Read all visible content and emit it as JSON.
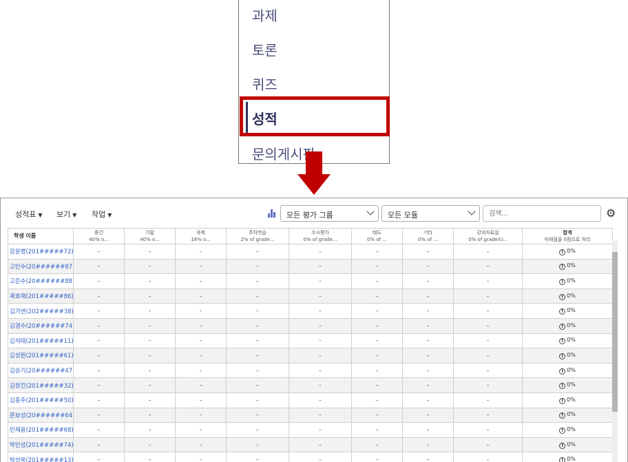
{
  "menu": {
    "items": [
      {
        "label": "과제",
        "active": false
      },
      {
        "label": "토론",
        "active": false
      },
      {
        "label": "퀴즈",
        "active": false
      },
      {
        "label": "성적",
        "active": true
      },
      {
        "label": "문의게시판",
        "active": false
      }
    ]
  },
  "toolbar": {
    "gradebook_label": "성적표",
    "view_label": "보기",
    "action_label": "작업",
    "group_select": "모든 평가 그룹",
    "module_select": "모든 모듈",
    "search_placeholder": "검색..."
  },
  "table": {
    "student_header": "학생 이름",
    "columns": [
      {
        "title": "중간",
        "sub": "40% o..."
      },
      {
        "title": "기말",
        "sub": "40% o..."
      },
      {
        "title": "과제",
        "sub": "18% o..."
      },
      {
        "title": "주차학습",
        "sub": "2% of grade..."
      },
      {
        "title": "수시평가",
        "sub": "0% of grade..."
      },
      {
        "title": "태도",
        "sub": "0% of ..."
      },
      {
        "title": "기타",
        "sub": "0% of ..."
      },
      {
        "title": "강의자료실",
        "sub": "0% of grade/U..."
      }
    ],
    "total_header": {
      "title": "합계",
      "sub": "미채점을 0점으로 처리"
    },
    "empty_value": "–",
    "total_value": "0%",
    "students": [
      "강윤병(201#####72)",
      "고민수(20######87)",
      "고은수(20######88)",
      "곽호재(201#####86)",
      "김가연(202#####38)",
      "김경수(20######74)",
      "김석태(201#####11)",
      "김성원(201#####61)",
      "김승기(20######47)",
      "김창진(201#####32)",
      "김홍주(201#####50)",
      "문보성(20######64)",
      "민재용(201#####68)",
      "박민성(201#####74)",
      "박성욱(201#####13)"
    ]
  },
  "colors": {
    "highlight": "#c00000",
    "link": "#2f5fc4",
    "menu_text": "#4a4f7a"
  }
}
